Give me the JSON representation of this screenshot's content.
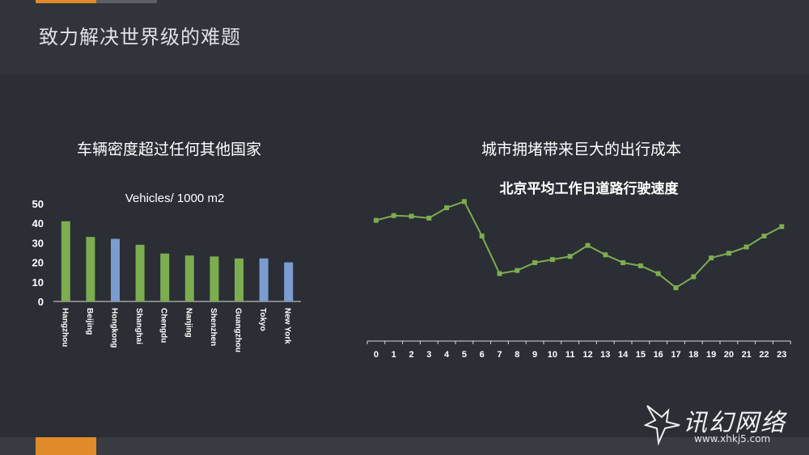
{
  "slide": {
    "title": "致力解决世界级的难题"
  },
  "left_panel": {
    "title": "车辆密度超过任何其他国家"
  },
  "right_panel": {
    "title": "城市拥堵带来巨大的出行成本"
  },
  "chart_data": [
    {
      "type": "bar",
      "title": "Vehicles/ 1000 m2",
      "categories": [
        "Hangzhou",
        "Beijing",
        "Hongkong",
        "Shanghai",
        "Chengdu",
        "Nanjing",
        "Shenzhen",
        "Guangzhou",
        "Tokyo",
        "New York"
      ],
      "values": [
        41,
        33,
        32,
        29,
        24.5,
        23.5,
        23,
        22,
        22,
        20
      ],
      "colors": [
        "#7cad4f",
        "#7cad4f",
        "#7b9cd0",
        "#7cad4f",
        "#7cad4f",
        "#7cad4f",
        "#7cad4f",
        "#7cad4f",
        "#7b9cd0",
        "#7b9cd0"
      ],
      "ylim": [
        0,
        50
      ],
      "yticks": [
        0,
        10,
        20,
        30,
        40,
        50
      ],
      "grid": false
    },
    {
      "type": "line",
      "title": "北京平均工作日道路行驶速度",
      "x": [
        0,
        1,
        2,
        3,
        4,
        5,
        6,
        7,
        8,
        9,
        10,
        11,
        12,
        13,
        14,
        15,
        16,
        17,
        18,
        19,
        20,
        21,
        22,
        23
      ],
      "y": [
        33.5,
        35,
        34.8,
        34.2,
        37.5,
        39.5,
        28.5,
        16.5,
        17.5,
        20,
        21,
        22,
        25.5,
        22.5,
        20,
        19,
        16.5,
        12,
        15.5,
        21.5,
        23,
        25,
        28.5,
        31.5
      ],
      "color": "#7cad4f",
      "ylim": [
        -5,
        45
      ],
      "grid": false
    }
  ],
  "watermark": {
    "text": "讯幻网络",
    "url": "www.xhkj5.com"
  }
}
